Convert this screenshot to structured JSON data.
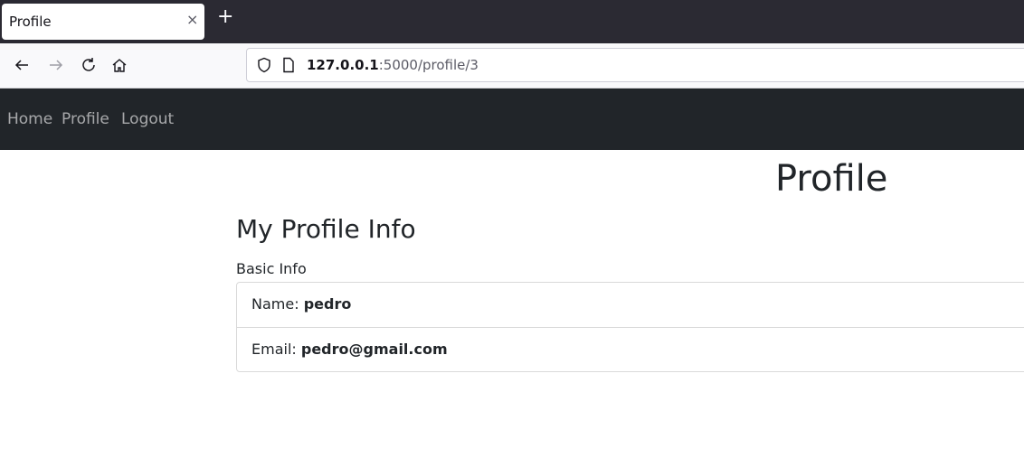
{
  "browser": {
    "tab_title": "Profile",
    "tab_close": "×",
    "new_tab": "+",
    "url_host": "127.0.0.1",
    "url_rest": ":5000/profile/3"
  },
  "nav": {
    "links": [
      "Home",
      "Profile",
      "Logout"
    ]
  },
  "page": {
    "title": "Profile",
    "section_title": "My Profile Info",
    "subtitle": "Basic Info",
    "fields": [
      {
        "label": "Name: ",
        "value": "pedro"
      },
      {
        "label": "Email: ",
        "value": "pedro@gmail.com"
      }
    ]
  },
  "colors": {
    "navbar_bg": "#212529",
    "tabstrip_bg": "#2b2a33",
    "toolbar_bg": "#f9f9fb"
  }
}
